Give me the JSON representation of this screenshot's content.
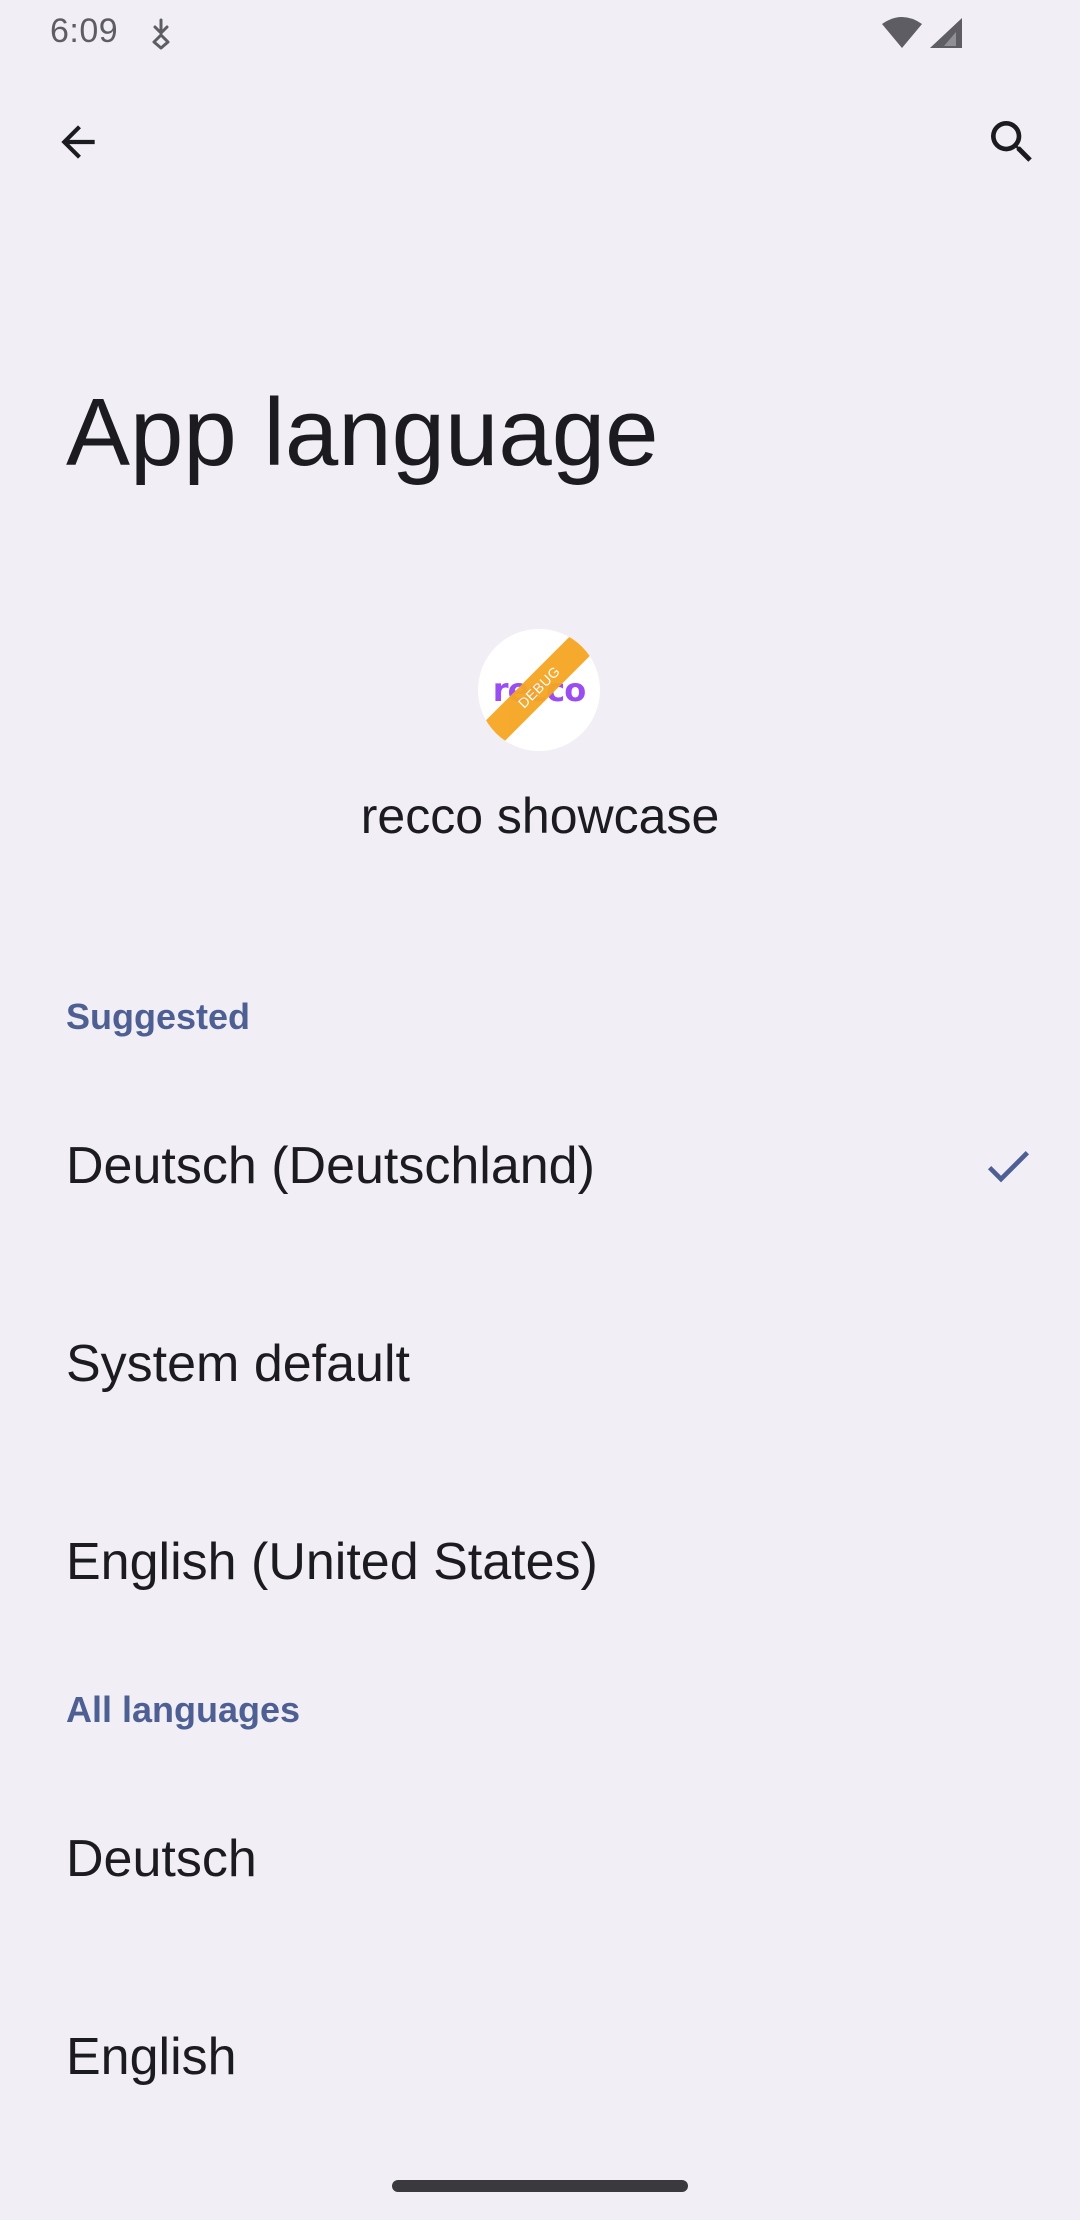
{
  "status_bar": {
    "time": "6:09",
    "notification_icon": "download-badge-icon",
    "wifi_icon": "wifi-icon",
    "signal_icon": "cell-signal-icon"
  },
  "toolbar": {
    "back_icon": "arrow-back-icon",
    "search_icon": "search-icon"
  },
  "page": {
    "title": "App language"
  },
  "app": {
    "name": "recco showcase",
    "icon_text": "recco",
    "icon_ribbon": "DEBUG",
    "brand_color": "#9A4DF2",
    "ribbon_color": "#F5A623"
  },
  "sections": {
    "suggested": {
      "title": "Suggested",
      "items": [
        {
          "label": "Deutsch (Deutschland)",
          "selected": true
        },
        {
          "label": "System default",
          "selected": false
        },
        {
          "label": "English (United States)",
          "selected": false
        }
      ]
    },
    "all": {
      "title": "All languages",
      "items": [
        {
          "label": "Deutsch",
          "selected": false
        },
        {
          "label": "English",
          "selected": false
        }
      ]
    }
  },
  "colors": {
    "background": "#F1EFF5",
    "section_header": "#4E5F94",
    "check": "#4E5F94",
    "text": "#1C1B20"
  }
}
